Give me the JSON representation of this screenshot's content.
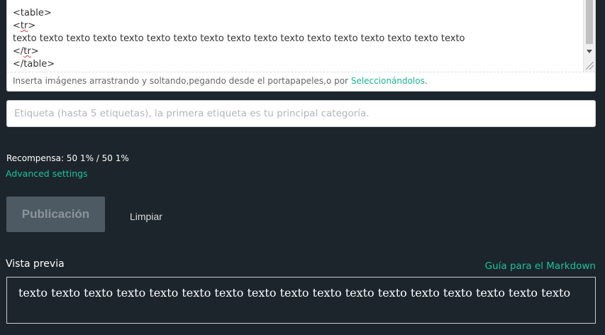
{
  "editor": {
    "lines": {
      "line1": "<table>",
      "line2_pre": "<",
      "line2_word": "tr",
      "line2_post": ">",
      "line3": "texto texto texto texto texto texto texto texto texto texto texto texto texto texto texto texto texto",
      "line4_pre": "</",
      "line4_word": "tr",
      "line4_post": ">",
      "line5": "</table>"
    },
    "drop_hint": "Inserta imágenes arrastrando y soltando,pegando desde el portapapeles,o por ",
    "drop_link": "Seleccionándolos",
    "drop_end": "."
  },
  "tags": {
    "placeholder": "Etiqueta (hasta 5 etiquetas), la primera etiqueta es tu principal categoría.",
    "value": ""
  },
  "reward": {
    "label": "Recompensa: 50 1% / 50 1%"
  },
  "advanced_settings": "Advanced settings",
  "buttons": {
    "publish": "Publicación",
    "clear": "Limpiar"
  },
  "preview": {
    "label": "Vista previa",
    "markdown_guide": "Guía para el Markdown",
    "content": "texto texto texto texto texto texto texto texto texto texto texto texto texto texto texto texto texto"
  },
  "colors": {
    "background": "#1c252b",
    "accent": "#1ac29f",
    "button_disabled": "#4e5a63"
  }
}
